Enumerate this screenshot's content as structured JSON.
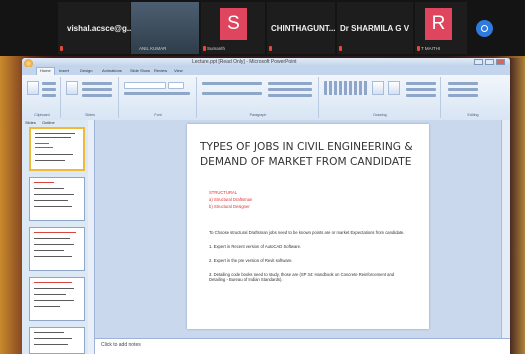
{
  "meeting": {
    "participants": [
      {
        "name": "vishal.acsce@g...",
        "sub": "",
        "avatar": ""
      },
      {
        "name": "",
        "sub": "ANIL KUMAR",
        "avatar": ""
      },
      {
        "name": "",
        "sub": "Sumanth",
        "avatar": "S",
        "color": "#e0455e"
      },
      {
        "name": "CHINTHAGUNT...",
        "sub": "",
        "avatar": ""
      },
      {
        "name": "Dr SHARMILA G V",
        "sub": "",
        "avatar": ""
      },
      {
        "name": "",
        "sub": "T MAITHI",
        "avatar": "R",
        "color": "#e0455e"
      }
    ]
  },
  "window": {
    "title": "Lecture.ppt [Read Only] - Microsoft PowerPoint",
    "tabs": [
      "Home",
      "Insert",
      "Design",
      "Animations",
      "Slide Show",
      "Review",
      "View"
    ],
    "groups": [
      "Clipboard",
      "Slides",
      "Font",
      "Paragraph",
      "Drawing",
      "Editing"
    ],
    "pane_tabs": [
      "Slides",
      "Outline"
    ],
    "notes_placeholder": "Click to add notes"
  },
  "slide": {
    "title": "TYPES OF JOBS IN CIVIL ENGINEERING & DEMAND OF MARKET FROM CANDIDATE",
    "heading": "STRUCTURAL",
    "sub_a": "a)   Structural Draftsman",
    "sub_b": "b)   Structural Designer",
    "intro": "To Choose structural Draftsman jobs need to be known points are or market Expectations from candidate.",
    "p1": "1.   Expert in Recent version of AutoCAD Software.",
    "p2": "2.   Expert in the pre version of Revit software.",
    "p3": "3.   Detailing code books need to study, those are (SP 34: Handbook on Concrete Reinforcement and Detailing - Bureau of Indian Standards)."
  }
}
